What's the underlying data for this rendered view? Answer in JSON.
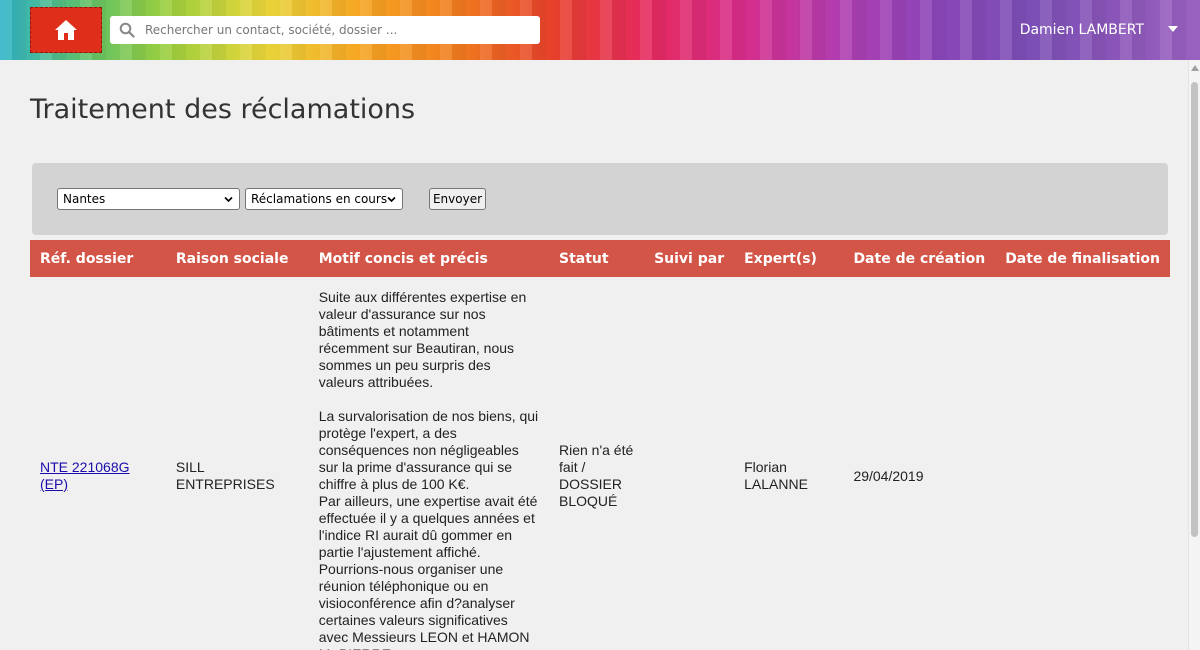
{
  "header": {
    "search_placeholder": "Rechercher un contact, société, dossier ...",
    "user_name": "Damien LAMBERT",
    "home_color": "#df2f1b"
  },
  "page": {
    "title": "Traitement des réclamations"
  },
  "filters": {
    "city_selected": "Nantes",
    "status_selected": "Réclamations en cours",
    "send_label": "Envoyer"
  },
  "table": {
    "header_color": "#d35548",
    "columns": [
      "Réf. dossier",
      "Raison sociale",
      "Motif concis et précis",
      "Statut",
      "Suivi par",
      "Expert(s)",
      "Date de création",
      "Date de finalisation"
    ],
    "rows": [
      {
        "ref": "NTE 221068G (EP)",
        "raison_sociale": "SILL ENTREPRISES",
        "motif": "Suite aux différentes expertise en valeur d'assurance sur nos bâtiments et notamment récemment sur Beautiran, nous sommes un peu surpris des valeurs attribuées.\n\nLa survalorisation de nos biens, qui protège l'expert, a des conséquences non négligeables sur la prime d'assurance qui se chiffre à plus de 100 K€.\nPar ailleurs, une expertise avait été effectuée il y a quelques années et l'indice RI aurait dû gommer en partie l'ajustement affiché.\nPourrions-nous organiser une réunion téléphonique ou en visioconférence afin d?analyser certaines valeurs significatives avec Messieurs LEON et HAMON\nMr PIERRE",
        "statut": "Rien n'a été fait / DOSSIER BLOQUÉ",
        "suivi_par": "",
        "experts": "Florian LALANNE",
        "date_creation": "29/04/2019",
        "date_finalisation": ""
      }
    ]
  }
}
